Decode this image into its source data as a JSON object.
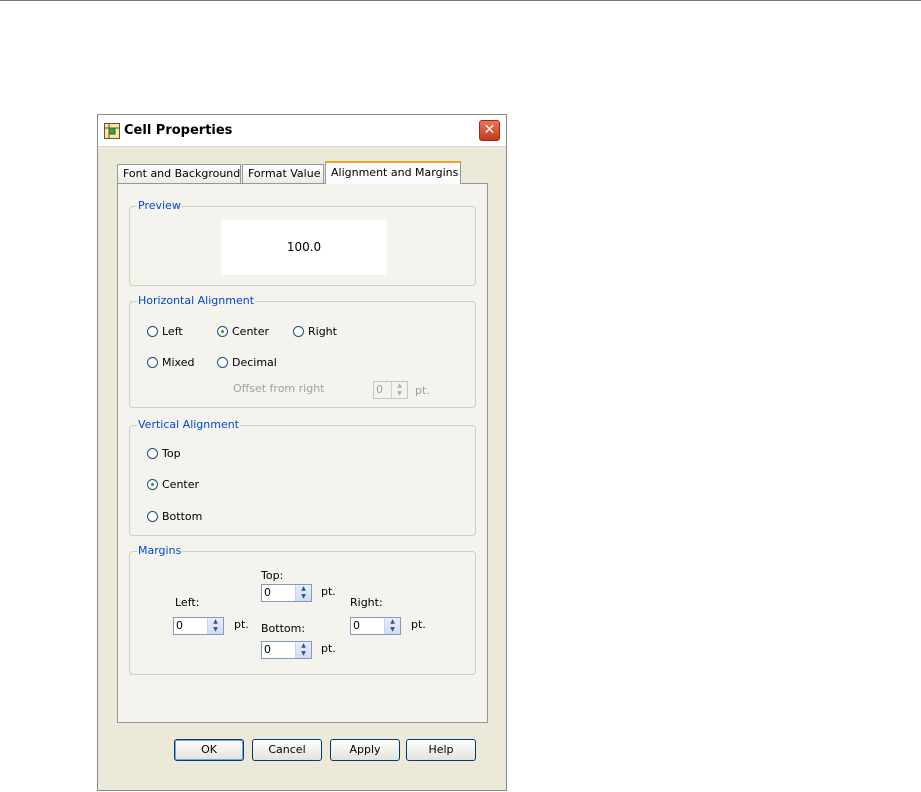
{
  "dialog": {
    "title": "Cell Properties",
    "close_glyph": "✕",
    "icon": "table-cell-icon"
  },
  "tabs": [
    {
      "label": "Font and Background"
    },
    {
      "label": "Format Value"
    },
    {
      "label": "Alignment and Margins",
      "active": true
    }
  ],
  "preview": {
    "group_label": "Preview",
    "value": "100.0"
  },
  "horizontal": {
    "group_label": "Horizontal Alignment",
    "options": [
      "Left",
      "Center",
      "Right",
      "Mixed",
      "Decimal"
    ],
    "selected": "Center",
    "offset_label": "Offset from right",
    "offset_value": "0",
    "offset_unit": "pt."
  },
  "vertical": {
    "group_label": "Vertical Alignment",
    "options": [
      "Top",
      "Center",
      "Bottom"
    ],
    "selected": "Center"
  },
  "margins": {
    "group_label": "Margins",
    "top_label": "Top:",
    "top_value": "0",
    "left_label": "Left:",
    "left_value": "0",
    "right_label": "Right:",
    "right_value": "0",
    "bottom_label": "Bottom:",
    "bottom_value": "0",
    "unit": "pt."
  },
  "buttons": {
    "ok": "OK",
    "cancel": "Cancel",
    "apply": "Apply",
    "help": "Help"
  },
  "colors": {
    "group_title": "#0046d5",
    "active_tab_accent": "#f4a524",
    "close_button": "#c4391c"
  }
}
